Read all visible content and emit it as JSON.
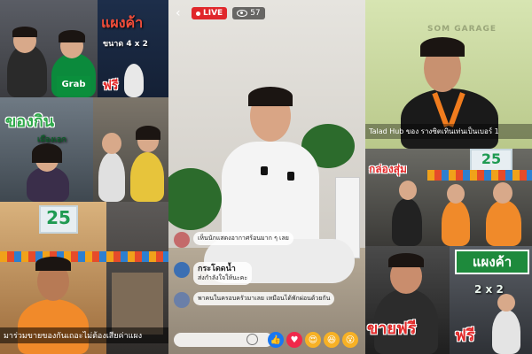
{
  "live": {
    "status_label": "LIVE",
    "viewer_count": "57",
    "comment_placeholder": "",
    "comments": [
      {
        "name": "",
        "text": "เห็นนักแสดงอากาศร้อนมาก ๆ เลย",
        "avatar_color": "#c46a6a"
      },
      {
        "name": "กระโดดน้ำ",
        "text": "ส่งกำลังใจให้นะคะ",
        "avatar_color": "#3b6fb3"
      },
      {
        "name": "",
        "text": "พาคนในครอบครัวมาเลย เหมือนได้พักผ่อนด้วยกัน",
        "avatar_color": "#6a7fa8"
      }
    ],
    "reactions": [
      {
        "name": "like-reaction-icon",
        "glyph": "👍",
        "color": "#1877f2"
      },
      {
        "name": "love-reaction-icon",
        "glyph": "♥",
        "color": "#f0284a"
      },
      {
        "name": "care-reaction-icon",
        "glyph": "😍",
        "color": "#f7b125"
      },
      {
        "name": "haha-reaction-icon",
        "glyph": "😆",
        "color": "#f7b125"
      },
      {
        "name": "wow-reaction-icon",
        "glyph": "😮",
        "color": "#f7b125"
      }
    ]
  },
  "left_collage": {
    "top_right_sign": "แผงค้า",
    "size_label": "ขนาด 4 x 2",
    "free_label": "ฟรี",
    "grab_label": "Grab",
    "food_title": "ของกิน",
    "food_subtitle": "เมืองเอก",
    "sign_number": "25",
    "bottom_caption": "มาร่วมขายของกันเถอะไม่ต้องเสียค่าแผง"
  },
  "right_collage": {
    "garage_sign": "SOM GARAGE",
    "caption": "Talad Hub ของ รางซิตเทินเท่นเป็นเบอร์ 1",
    "stall_label": "กล่องสุ่ม",
    "sign_number": "25",
    "stall_sign": "แผงค้า",
    "size_label": "2 x 2",
    "free_sell_label": "ขายฟรี",
    "free_label": "ฟรี"
  }
}
